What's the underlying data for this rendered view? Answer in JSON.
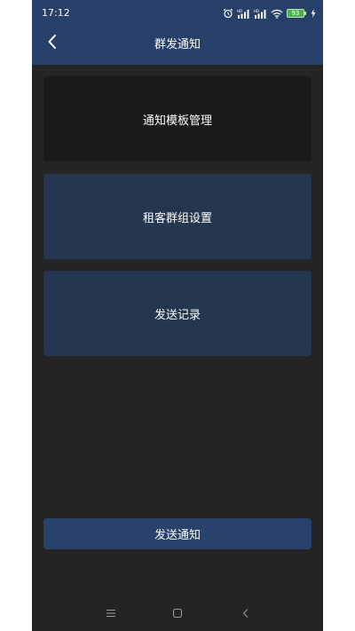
{
  "status_bar": {
    "time": "17:12",
    "battery_level": "93",
    "icons": [
      "alarm-icon",
      "signal-hd-icon",
      "signal-icon",
      "wifi-icon",
      "battery-icon",
      "charging-icon"
    ]
  },
  "nav": {
    "title": "群发通知",
    "back_icon": "chevron-left-icon"
  },
  "menu": {
    "items": [
      {
        "label": "通知模板管理"
      },
      {
        "label": "租客群组设置"
      },
      {
        "label": "发送记录"
      }
    ]
  },
  "actions": {
    "send_label": "发送通知"
  },
  "system_nav": {
    "icons": [
      "menu-icon",
      "home-icon",
      "back-icon"
    ]
  },
  "colors": {
    "header": "#26406a",
    "background": "#242424",
    "card_dark": "#1b1b1b",
    "card_blue": "#243650",
    "button": "#29426b",
    "text": "#ffffff"
  }
}
